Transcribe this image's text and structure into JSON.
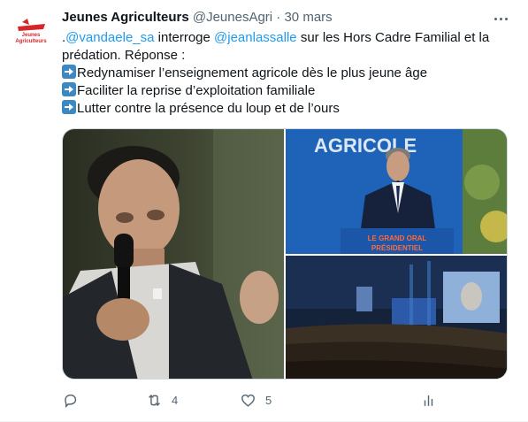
{
  "tweet": {
    "author_name": "Jeunes Agriculteurs",
    "author_handle": "@JeunesAgri",
    "separator": "·",
    "date": "30 mars",
    "avatar_logo_text": [
      "Jeunes",
      "Agriculteurs"
    ],
    "text": {
      "prefix": ".",
      "mention1": "@vandaele_sa",
      "part1": " interroge ",
      "mention2": "@jeanlassalle",
      "part2": " sur les Hors Cadre Familial et la",
      "line2": "prédation. Réponse :",
      "bullets": [
        "Redynamiser l’enseignement agricole dès le plus jeune âge",
        "Faciliter la reprise d’exploitation familiale",
        "Lutter contre la présence du loup et de l’ours"
      ]
    },
    "media": {
      "photo2_banner": "AGRICOLE",
      "photo2_podium": "LE GRAND ORAL",
      "photo2_podium_sub": "PRÉSIDENTIEL"
    },
    "actions": {
      "reply_icon": "reply-icon",
      "retweet_icon": "retweet-icon",
      "retweet_count": "4",
      "like_icon": "heart-icon",
      "like_count": "5",
      "analytics_icon": "analytics-icon"
    }
  },
  "colors": {
    "text_primary": "#0f1419",
    "text_secondary": "#536471",
    "link": "#1d9bf0",
    "arrow_emoji_bg": "#3b88c3",
    "brand_red": "#d6262b"
  }
}
